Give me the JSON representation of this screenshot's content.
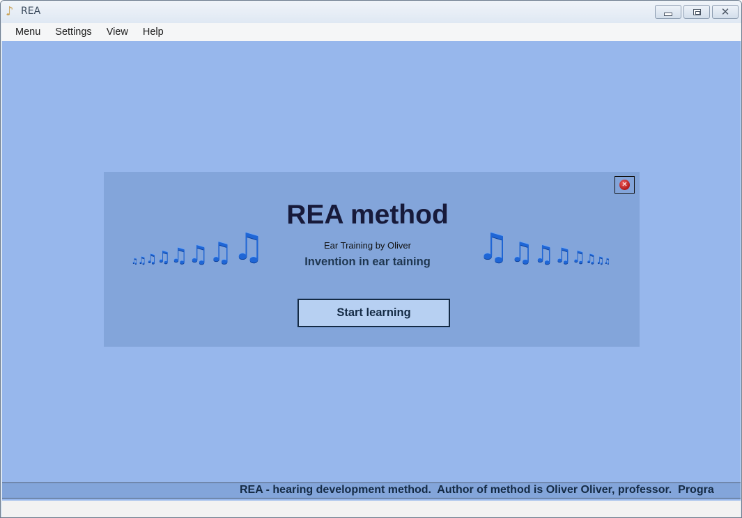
{
  "window": {
    "title": "REA",
    "app_icon": "music-note-icon",
    "controls": {
      "minimize": "minimize-icon",
      "maximize": "restore-icon",
      "close": "close-icon"
    }
  },
  "menubar": {
    "items": [
      {
        "label": "Menu"
      },
      {
        "label": "Settings"
      },
      {
        "label": "View"
      },
      {
        "label": "Help"
      }
    ]
  },
  "dialog": {
    "title": "REA method",
    "subtitle": "Ear Training by Oliver",
    "tagline": "Invention in ear taining",
    "start_button": "Start learning",
    "close_icon": "close-circle-icon",
    "decoration": "music-notes-icon"
  },
  "status": {
    "ticker": "REA - hearing development method.  Author of method is Oliver Oliver, professor.  Progra"
  },
  "colors": {
    "client_bg": "#97b7ec",
    "dialog_bg": "#83a5da",
    "button_bg": "#b7d0f2",
    "text_dark": "#142a44"
  }
}
